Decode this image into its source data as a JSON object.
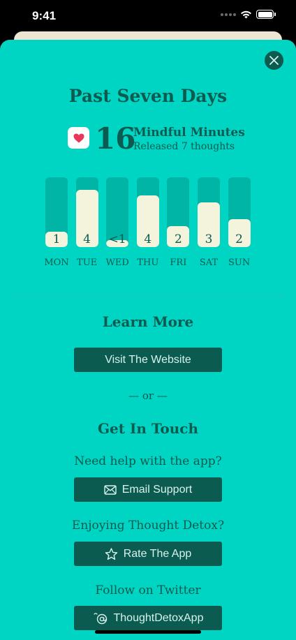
{
  "status_bar": {
    "time": "9:41"
  },
  "sheet": {
    "title": "Past Seven Days",
    "summary": {
      "minutes": "16",
      "minutes_label": "Mindful Minutes",
      "released": "Released 7 thoughts"
    },
    "chart_data": {
      "type": "bar",
      "categories": [
        "MON",
        "TUE",
        "WED",
        "THU",
        "FRI",
        "SAT",
        "SUN"
      ],
      "values": [
        1,
        4,
        0.5,
        4,
        2,
        3,
        2
      ],
      "labels": [
        "1",
        "4",
        "<1",
        "4",
        "2",
        "3",
        "2"
      ],
      "fill_fraction": [
        0.22,
        0.82,
        0.1,
        0.74,
        0.3,
        0.64,
        0.4
      ]
    },
    "learn_more": {
      "title": "Learn More",
      "website_button": "Visit The Website"
    },
    "or_text": "— or —",
    "get_in_touch": {
      "title": "Get In Touch",
      "help_prompt": "Need help with the app?",
      "email_button": "Email Support",
      "enjoy_prompt": "Enjoying Thought Detox?",
      "rate_button": "Rate The App",
      "twitter_prompt": "Follow on Twitter",
      "twitter_button": "ThoughtDetoxApp"
    }
  },
  "colors": {
    "sheet_bg": "#00d4c2",
    "dark_teal": "#0b5b50",
    "bar_track": "#00b5a6",
    "bar_fill": "#f4f3dc",
    "heart": "#e8375a"
  },
  "icons": [
    "wifi-icon",
    "battery-icon",
    "close-icon",
    "heart-icon",
    "mail-icon",
    "star-icon",
    "at-icon"
  ]
}
